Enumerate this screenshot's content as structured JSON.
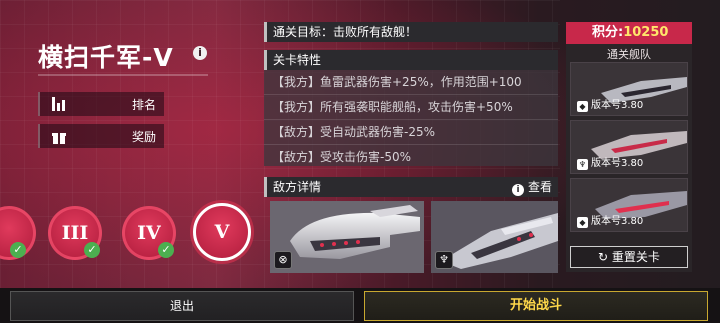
{
  "stage": {
    "title": "横扫千军-V",
    "info_glyph": "i"
  },
  "side_buttons": {
    "rank": "排名",
    "reward": "奖励"
  },
  "stages": [
    {
      "label": "III",
      "cleared": true
    },
    {
      "label": "IV",
      "cleared": true
    },
    {
      "label": "V",
      "cleared": false,
      "active": true
    }
  ],
  "objective": {
    "text": "通关目标：击败所有敌舰！"
  },
  "features": {
    "title": "关卡特性",
    "items": [
      "【我方】鱼雷武器伤害+25%，作用范围+100",
      "【我方】所有强袭职能舰船，攻击伤害+50%",
      "【敌方】受自动武器伤害-25%",
      "【敌方】受攻击伤害-50%"
    ]
  },
  "enemy": {
    "title": "敌方详情",
    "view_label": "查看",
    "cards": [
      {
        "icon": "crosshair-icon"
      },
      {
        "icon": "carrier-icon"
      }
    ]
  },
  "score": {
    "label": "积分:",
    "value": "10250"
  },
  "fleet": {
    "title": "通关舰队",
    "ships": [
      {
        "version": "版本号3.80"
      },
      {
        "version": "版本号3.80"
      },
      {
        "version": "版本号3.80"
      }
    ]
  },
  "reset_label": "重置关卡",
  "bottom": {
    "exit_label": "退出",
    "start_label": "开始战斗"
  },
  "colors": {
    "accent": "#c8284a",
    "score_value": "#ffe66b",
    "start_text": "#ffd84a",
    "check": "#4caf50"
  }
}
